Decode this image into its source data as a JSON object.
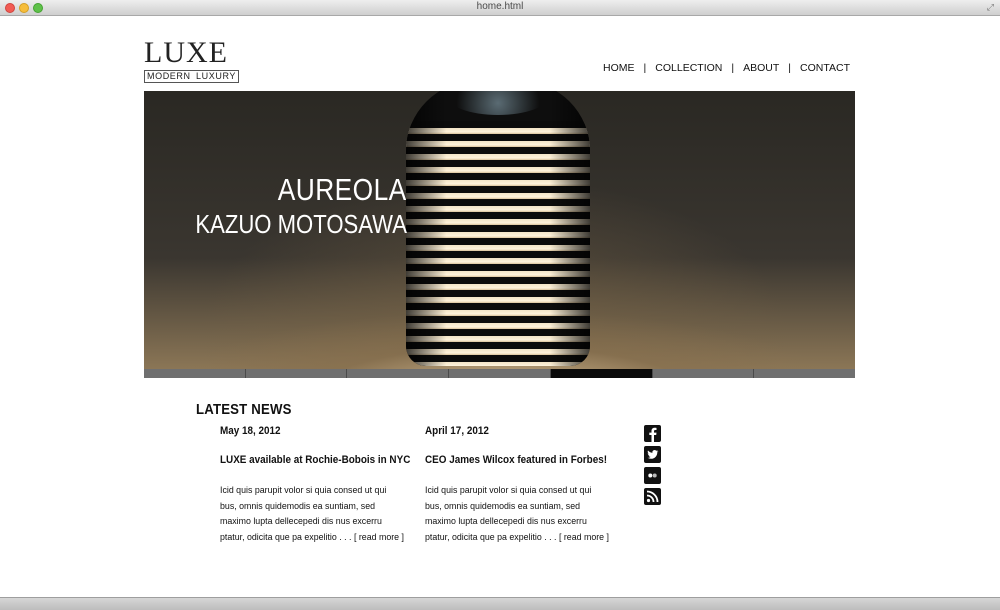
{
  "window": {
    "title": "home.html"
  },
  "logo": {
    "main": "LUXE",
    "sub_left": "MODERN",
    "sub_right": "LUXURY"
  },
  "nav": {
    "items": [
      "HOME",
      "COLLECTION",
      "ABOUT",
      "CONTACT"
    ],
    "separator": "|"
  },
  "hero": {
    "title": "AUREOLA",
    "subtitle": "KAZUO MOTOSAWA",
    "slides_count": 7,
    "active_slide_index": 4
  },
  "news": {
    "heading": "LATEST NEWS",
    "items": [
      {
        "date": "May 18, 2012",
        "headline": "LUXE available at Rochie-Bobois in NYC",
        "body": "Icid quis parupit volor si quia consed ut qui bus, omnis quidemodis ea suntiam, sed maximo lupta dellecepedi dis nus excerru ptatur, odicita que pa expelitio . . .",
        "more": "[ read more ]"
      },
      {
        "date": "April 17, 2012",
        "headline": "CEO James Wilcox featured in Forbes!",
        "body": "Icid quis parupit volor si quia consed ut qui bus, omnis quidemodis ea suntiam, sed maximo lupta dellecepedi dis nus excerru ptatur, odicita que pa expelitio . . .",
        "more": "[ read more ]"
      }
    ]
  },
  "social": {
    "icons": [
      "facebook-icon",
      "twitter-icon",
      "flickr-icon",
      "rss-icon"
    ]
  }
}
